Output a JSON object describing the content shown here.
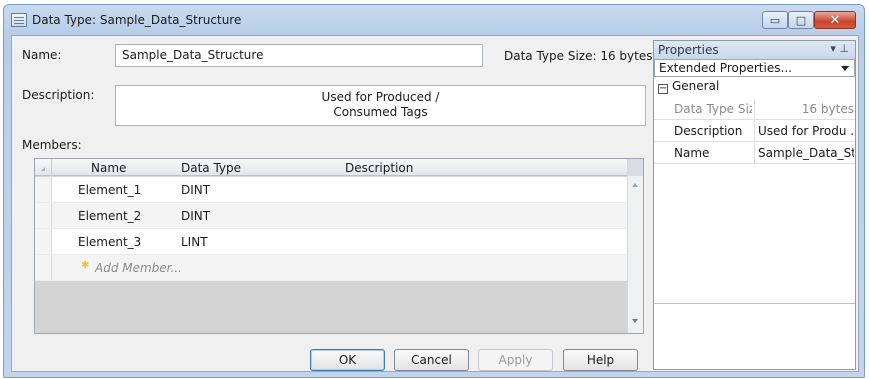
{
  "window": {
    "title": "Data Type: Sample_Data_Structure",
    "minimize_glyph": "▭",
    "maximize_glyph": "□",
    "close_glyph": "✕"
  },
  "form": {
    "name_label": "Name:",
    "name_value": "Sample_Data_Structure",
    "size_label": "Data Type Size: 16 bytes",
    "description_label": "Description:",
    "description_line1": "Used for Produced /",
    "description_line2": "Consumed Tags",
    "members_label": "Members:"
  },
  "members_grid": {
    "columns": [
      "Name",
      "Data Type",
      "Description"
    ],
    "rows": [
      {
        "name": "Element_1",
        "type": "DINT",
        "description": ""
      },
      {
        "name": "Element_2",
        "type": "DINT",
        "description": ""
      },
      {
        "name": "Element_3",
        "type": "LINT",
        "description": ""
      }
    ],
    "add_member_label": "Add Member...",
    "add_member_icon": "star-icon"
  },
  "buttons": {
    "ok": "OK",
    "cancel": "Cancel",
    "apply": "Apply",
    "help": "Help"
  },
  "properties": {
    "title": "Properties",
    "pin_glyph": "▾ ⊥",
    "dropdown_value": "Extended Properties...",
    "category": "General",
    "expander_glyph": "−",
    "rows": [
      {
        "name": "Data Type Size",
        "value": "16 bytes"
      },
      {
        "name": "Description",
        "value": "Used for Produ ..."
      },
      {
        "name": "Name",
        "value": "Sample_Data_Stru"
      }
    ]
  },
  "colors": {
    "title_bar": "#c9daf0",
    "close_button": "#c8462e",
    "panel_bg": "#f0f0f0"
  }
}
